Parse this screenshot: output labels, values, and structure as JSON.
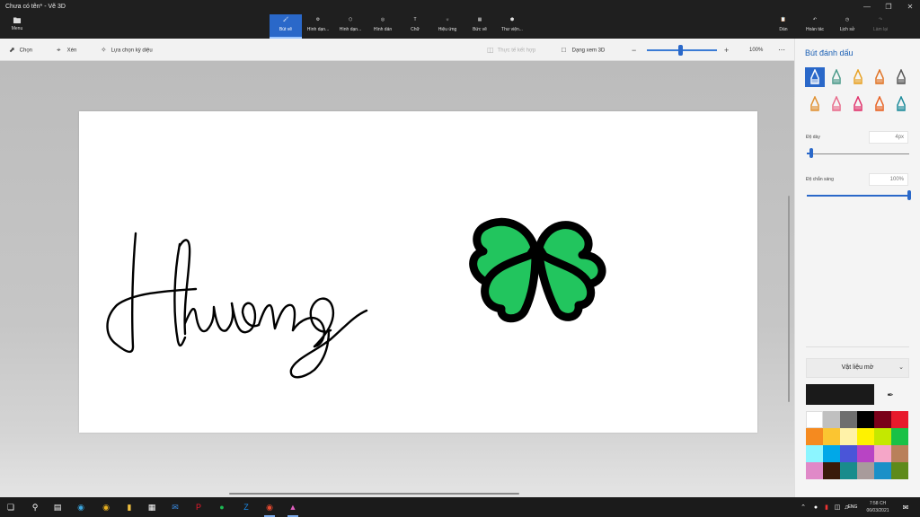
{
  "app": {
    "title": "Chưa có tên* - Vẽ 3D",
    "menu_label": "Menu"
  },
  "ribbon": {
    "tabs": [
      {
        "label": "Bút vẽ",
        "icon": "brush-icon",
        "active": true
      },
      {
        "label": "Hình dạn...",
        "icon": "2d-shapes-icon",
        "active": false
      },
      {
        "label": "Hình dạn...",
        "icon": "3d-shapes-icon",
        "active": false
      },
      {
        "label": "Hình dán",
        "icon": "stickers-icon",
        "active": false
      },
      {
        "label": "Chữ",
        "icon": "text-icon",
        "active": false
      },
      {
        "label": "Hiệu ứng",
        "icon": "effects-icon",
        "active": false
      },
      {
        "label": "Bức vẽ",
        "icon": "canvas-icon",
        "active": false
      },
      {
        "label": "Thư viện...",
        "icon": "3d-library-icon",
        "active": false
      }
    ],
    "right": {
      "paste": "Dán",
      "undo": "Hoàn tác",
      "history": "Lịch sử",
      "redo": "Làm lại"
    }
  },
  "toolbar": {
    "select": "Chọn",
    "crop": "Xén",
    "magic_select": "Lựa chọn kỳ diệu",
    "mixed_reality": "Thực tế kết hợp",
    "view_3d": "Dạng xem 3D",
    "zoom": "100%",
    "zoom_fraction": 0.5
  },
  "canvas": {
    "handwriting": "Hương",
    "clover_fill": "#22c55e"
  },
  "panel": {
    "title": "Bút đánh dấu",
    "thickness_label": "Độ dày",
    "thickness_value": "4px",
    "opacity_label": "Độ chắn sáng",
    "opacity_value": "100%",
    "thickness_fraction": 0.04,
    "opacity_fraction": 1.0,
    "material": "Vật liệu mờ",
    "current_color": "#1a1a1a",
    "brushes": [
      {
        "name": "marker-icon",
        "color": "#2a68c9",
        "selected": true
      },
      {
        "name": "calligraphy-pen-icon",
        "color": "#4a9a8a"
      },
      {
        "name": "oil-brush-icon",
        "color": "#e8a020"
      },
      {
        "name": "watercolor-icon",
        "color": "#e07020"
      },
      {
        "name": "pixel-pen-icon",
        "color": "#555555"
      },
      {
        "name": "pencil-icon",
        "color": "#e09030"
      },
      {
        "name": "eraser-icon",
        "color": "#e86a8a"
      },
      {
        "name": "crayon-icon",
        "color": "#e0306a"
      },
      {
        "name": "spray-can-icon",
        "color": "#e86020"
      },
      {
        "name": "fill-icon",
        "color": "#1a8a9a"
      }
    ],
    "swatches": [
      "#ffffff",
      "#c0c0c0",
      "#6e6e6e",
      "#000000",
      "#7a0019",
      "#e8192c",
      "#f58a1f",
      "#fbc531",
      "#fff2a8",
      "#fff200",
      "#c4e800",
      "#19c146",
      "#8cf5ff",
      "#00a8e8",
      "#4a55d8",
      "#b844c4",
      "#f5a6c8",
      "#b9805a",
      "#e089c8",
      "#3a1a0a",
      "#198c8c",
      "#a89b9b",
      "#1a90c8",
      "#5e8a1a"
    ]
  },
  "taskbar": {
    "icons": [
      "windows-start-icon",
      "search-icon",
      "task-view-icon",
      "edge-icon",
      "chrome-canary-icon",
      "file-explorer-icon",
      "store-icon",
      "mail-icon",
      "pinterest-icon",
      "spotify-icon",
      "zalo-icon",
      "chrome-icon",
      "paint-3d-icon"
    ],
    "lang": "ENG",
    "time": "7:58 CH",
    "date": "06/03/2021"
  }
}
